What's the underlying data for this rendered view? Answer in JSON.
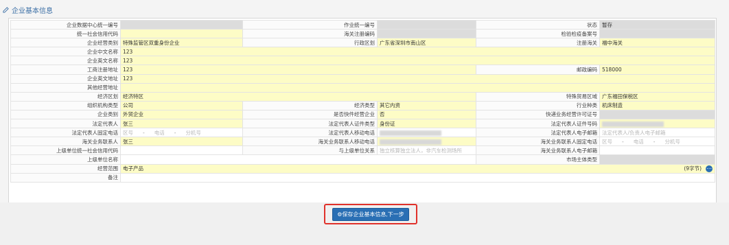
{
  "header": {
    "title": "企业基本信息"
  },
  "rows": [
    [
      {
        "t": "lbl",
        "v": "企业数据中心统一编号"
      },
      {
        "t": "gry",
        "v": ""
      },
      {
        "t": "lbl",
        "v": "作业统一编号"
      },
      {
        "t": "gry",
        "v": ""
      },
      {
        "t": "lbl",
        "v": "状态"
      },
      {
        "t": "gry",
        "v": "暂存"
      }
    ],
    [
      {
        "t": "lbl",
        "v": "统一社会信用代码"
      },
      {
        "t": "yel",
        "v": ""
      },
      {
        "t": "lbl",
        "v": "海关注册编码"
      },
      {
        "t": "gry",
        "v": ""
      },
      {
        "t": "lbl",
        "v": "检验检疫备案号"
      },
      {
        "t": "gry",
        "v": ""
      }
    ],
    [
      {
        "t": "lbl",
        "v": "企业经营类别"
      },
      {
        "t": "yel",
        "v": "特殊监管区双重身份企业"
      },
      {
        "t": "lbl",
        "v": "行政区划"
      },
      {
        "t": "yel",
        "v": "广东省深圳市南山区"
      },
      {
        "t": "lbl",
        "v": "注册海关"
      },
      {
        "t": "yel",
        "v": "福中海关"
      }
    ],
    [
      {
        "t": "lbl",
        "v": "企业中文名称"
      },
      {
        "t": "yel",
        "v": "123",
        "span": 5
      }
    ],
    [
      {
        "t": "lbl",
        "v": "企业英文名称"
      },
      {
        "t": "yel",
        "v": "123",
        "span": 5
      }
    ],
    [
      {
        "t": "lbl",
        "v": "工商注册地址"
      },
      {
        "t": "yel",
        "v": "123",
        "span": 3
      },
      {
        "t": "lbl",
        "v": "邮政编码"
      },
      {
        "t": "yel",
        "v": "518000"
      }
    ],
    [
      {
        "t": "lbl",
        "v": "企业英文地址"
      },
      {
        "t": "yel",
        "v": "123",
        "span": 5
      }
    ],
    [
      {
        "t": "lbl",
        "v": "其他经营地址"
      },
      {
        "t": "yel",
        "v": "",
        "span": 5
      }
    ],
    [
      {
        "t": "lbl",
        "v": "经济区划"
      },
      {
        "t": "yel",
        "v": "经济特区",
        "span": 3
      },
      {
        "t": "lbl",
        "v": "特殊贸易区域"
      },
      {
        "t": "yel",
        "v": "广东福田保税区"
      }
    ],
    [
      {
        "t": "lbl",
        "v": "组织机构类型"
      },
      {
        "t": "yel",
        "v": "公司"
      },
      {
        "t": "lbl",
        "v": "经济类型"
      },
      {
        "t": "yel",
        "v": "其它内资"
      },
      {
        "t": "lbl",
        "v": "行业种类"
      },
      {
        "t": "yel",
        "v": "机床制造"
      }
    ],
    [
      {
        "t": "lbl",
        "v": "企业类别"
      },
      {
        "t": "yel",
        "v": "外贸企业"
      },
      {
        "t": "lbl",
        "v": "是否快件经营企业"
      },
      {
        "t": "yel",
        "v": "否"
      },
      {
        "t": "lbl",
        "v": "快递业务经营许可证号"
      },
      {
        "t": "gry",
        "v": ""
      }
    ],
    [
      {
        "t": "lbl",
        "v": "法定代表人"
      },
      {
        "t": "yel",
        "v": "张三"
      },
      {
        "t": "lbl",
        "v": "法定代表人证件类型"
      },
      {
        "t": "yel",
        "v": "身份证"
      },
      {
        "t": "lbl",
        "v": "法定代表人证件号码"
      },
      {
        "t": "yel",
        "v": "",
        "blur": true
      }
    ],
    [
      {
        "t": "lbl",
        "v": "法定代表人固定电话"
      },
      {
        "t": "wht",
        "v": "",
        "phone": [
          "区号",
          "电话",
          "分机号"
        ]
      },
      {
        "t": "lbl",
        "v": "法定代表人移动电话"
      },
      {
        "t": "wht",
        "v": "",
        "blur": true
      },
      {
        "t": "lbl",
        "v": "法定代表人电子邮箱"
      },
      {
        "t": "wht",
        "v": "",
        "ph": "法定代表人/负责人电子邮箱"
      }
    ],
    [
      {
        "t": "lbl",
        "v": "海关业务联系人"
      },
      {
        "t": "yel",
        "v": "张三"
      },
      {
        "t": "lbl",
        "v": "海关业务联系人移动电话"
      },
      {
        "t": "yel",
        "v": "",
        "blur": true
      },
      {
        "t": "lbl",
        "v": "海关业务联系人固定电话"
      },
      {
        "t": "wht",
        "v": "",
        "phone": [
          "区号",
          "电话",
          "分机号"
        ]
      }
    ],
    [
      {
        "t": "lbl",
        "v": "上级单位统一社会信用代码"
      },
      {
        "t": "wht",
        "v": ""
      },
      {
        "t": "lbl",
        "v": "与上级单位关系"
      },
      {
        "t": "wht",
        "v": "",
        "ph": "独立核算独立法人，非汽车检测场所"
      },
      {
        "t": "lbl",
        "v": "海关业务联系人电子邮箱"
      },
      {
        "t": "wht",
        "v": ""
      }
    ],
    [
      {
        "t": "lbl",
        "v": "上级单位名称"
      },
      {
        "t": "wht",
        "v": "",
        "span": 3
      },
      {
        "t": "lbl",
        "v": "市场主体类型"
      },
      {
        "t": "gry",
        "v": ""
      }
    ],
    [
      {
        "t": "lbl",
        "v": "经营范围"
      },
      {
        "t": "yel",
        "v": "电子产品",
        "span": 5,
        "note": "(9字节)",
        "expand": true
      }
    ],
    [
      {
        "t": "lbl",
        "v": "备注"
      },
      {
        "t": "wht",
        "v": "",
        "span": 5
      }
    ]
  ],
  "footer": {
    "save_button": "保存企业基本信息,下一步"
  }
}
